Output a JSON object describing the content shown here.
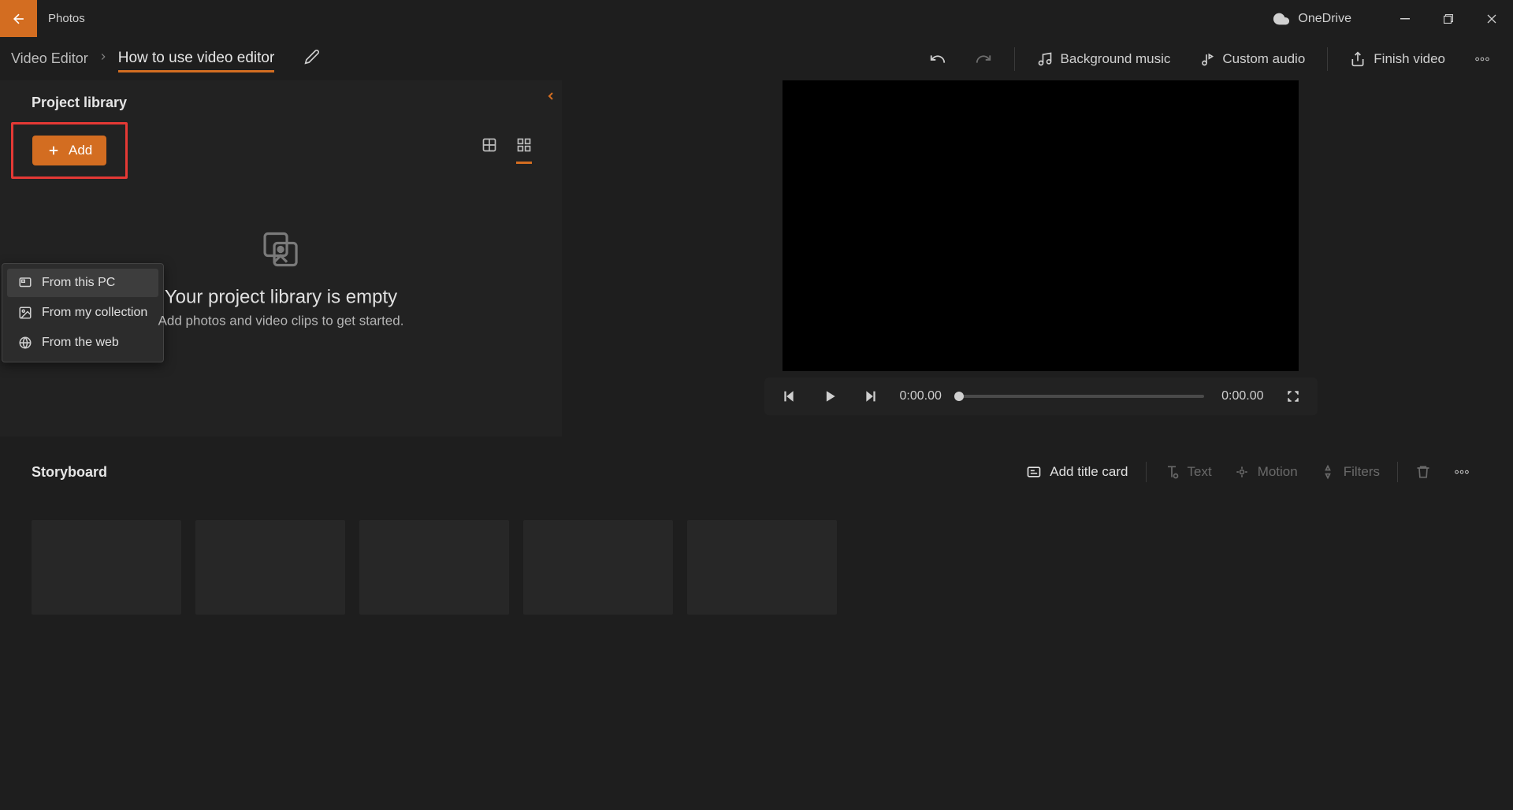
{
  "app_name": "Photos",
  "onedrive_label": "OneDrive",
  "breadcrumb": {
    "root": "Video Editor",
    "project_title": "How to use video editor"
  },
  "header": {
    "undo": "Undo",
    "redo": "Redo",
    "background_music": "Background music",
    "custom_audio": "Custom audio",
    "finish_video": "Finish video"
  },
  "library": {
    "title": "Project library",
    "add_label": "Add",
    "empty_title": "Your project library is empty",
    "empty_sub": "Add photos and video clips to get started."
  },
  "add_menu": {
    "from_pc": "From this PC",
    "from_collection": "From my collection",
    "from_web": "From the web"
  },
  "player": {
    "current_time": "0:00.00",
    "total_time": "0:00.00"
  },
  "storyboard": {
    "title": "Storyboard",
    "add_title_card": "Add title card",
    "text": "Text",
    "motion": "Motion",
    "filters": "Filters"
  },
  "colors": {
    "accent": "#d36d21",
    "highlight": "#e53935"
  }
}
